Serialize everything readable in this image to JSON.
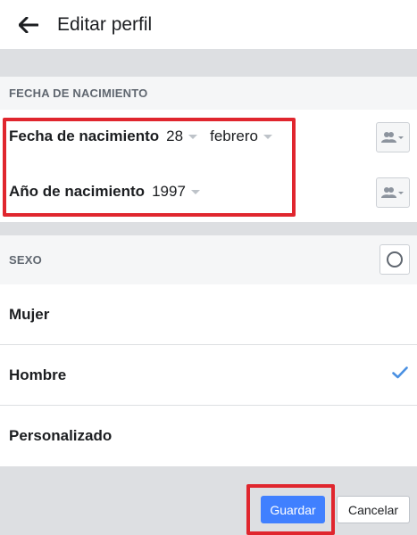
{
  "header": {
    "title": "Editar perfil",
    "back_icon": "arrow-left-icon"
  },
  "birth_section": {
    "heading": "FECHA DE NACIMIENTO",
    "date_label": "Fecha de nacimiento",
    "day_value": "28",
    "month_value": "febrero",
    "year_label": "Año de nacimiento",
    "year_value": "1997",
    "audience_icon": "friends-audience-icon"
  },
  "sex_section": {
    "heading": "SEXO",
    "options": [
      {
        "label": "Mujer",
        "selected": false
      },
      {
        "label": "Hombre",
        "selected": true
      },
      {
        "label": "Personalizado",
        "selected": false
      }
    ]
  },
  "footer": {
    "save_label": "Guardar",
    "cancel_label": "Cancelar"
  },
  "colors": {
    "accent": "#4080ff",
    "highlight_box": "#e0262e",
    "check": "#4a90e2"
  }
}
